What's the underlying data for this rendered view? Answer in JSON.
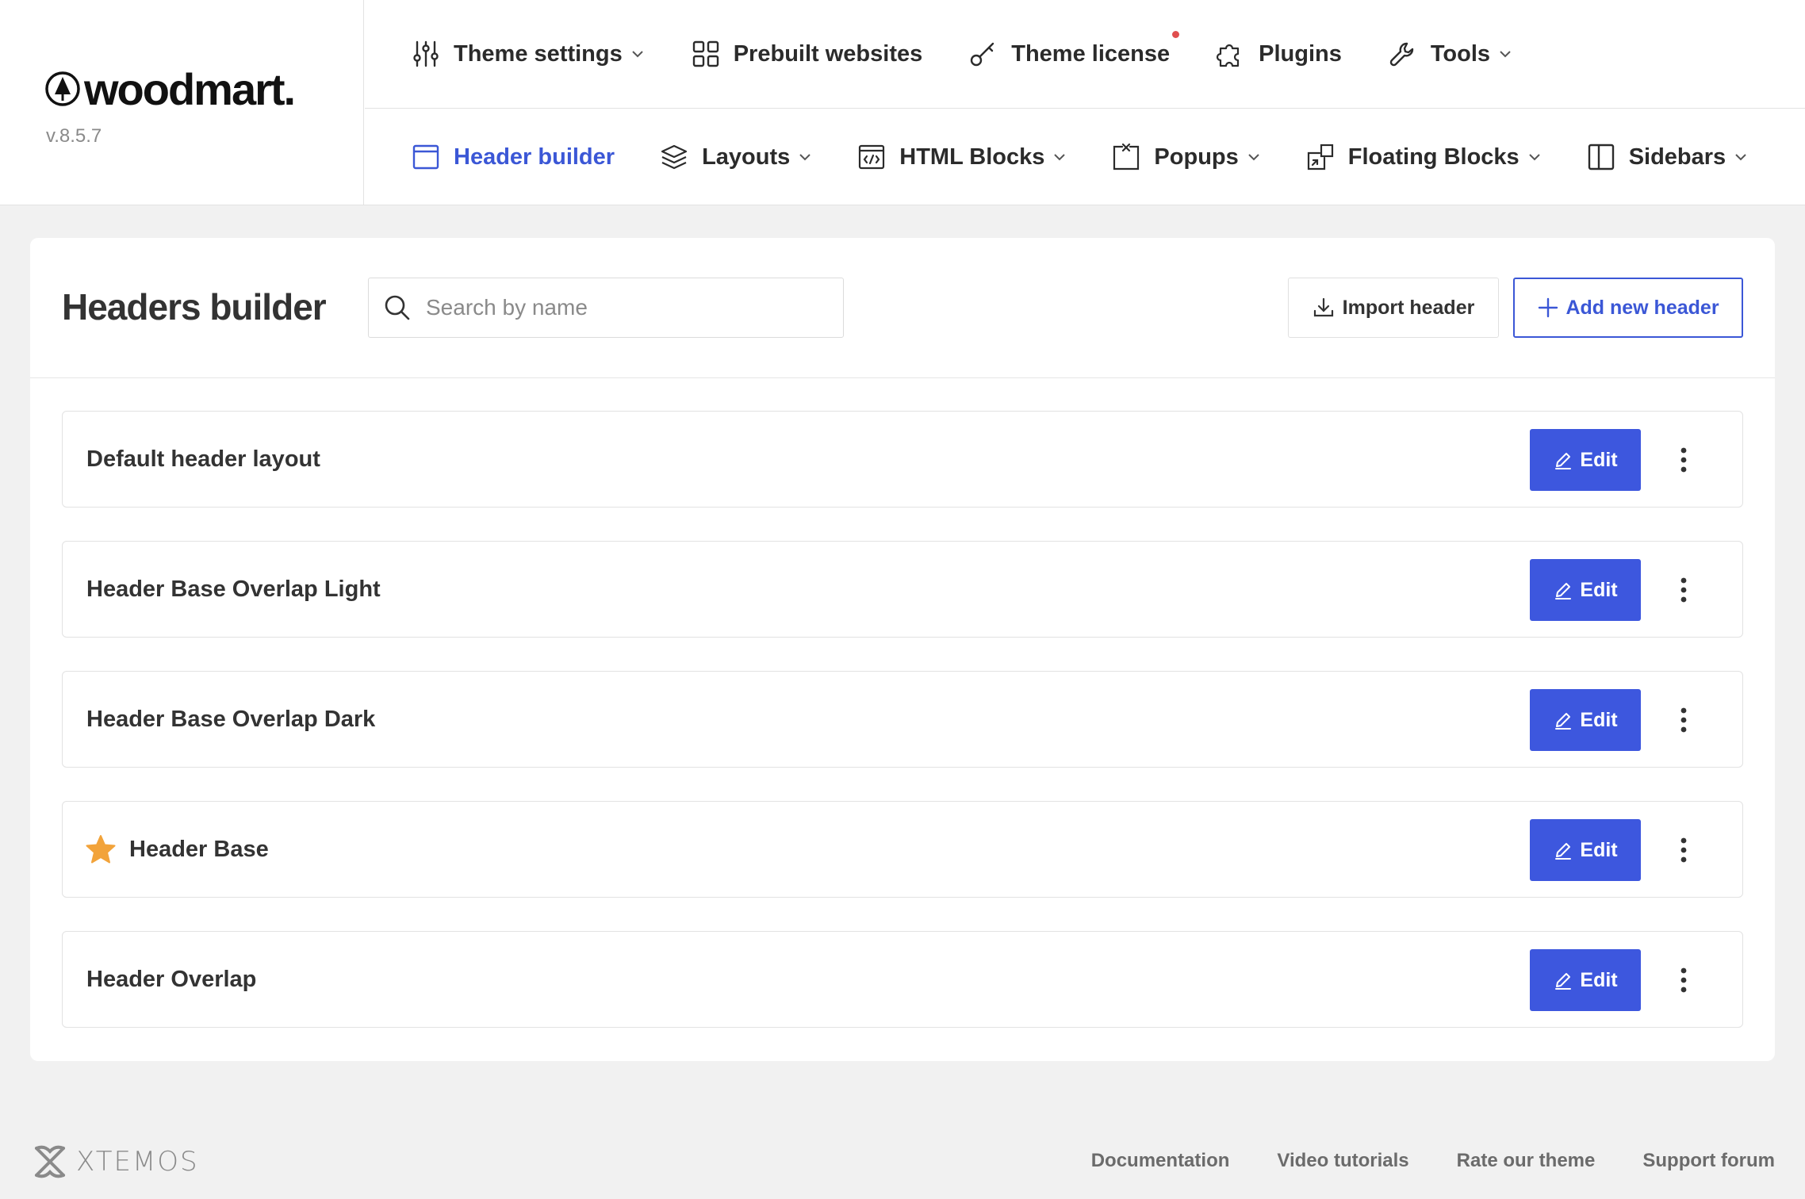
{
  "brand": {
    "name": "woodmart.",
    "version": "v.8.5.7"
  },
  "top_nav": [
    {
      "label": "Theme settings",
      "icon": "sliders-icon",
      "dropdown": true
    },
    {
      "label": "Prebuilt websites",
      "icon": "grid-icon",
      "dropdown": false
    },
    {
      "label": "Theme license",
      "icon": "key-icon",
      "dropdown": false,
      "notification_dot": true
    },
    {
      "label": "Plugins",
      "icon": "puzzle-icon",
      "dropdown": false
    },
    {
      "label": "Tools",
      "icon": "wrench-icon",
      "dropdown": true
    }
  ],
  "sub_nav": [
    {
      "label": "Header builder",
      "icon": "window-icon",
      "dropdown": false,
      "active": true
    },
    {
      "label": "Layouts",
      "icon": "layers-icon",
      "dropdown": true
    },
    {
      "label": "HTML Blocks",
      "icon": "code-window-icon",
      "dropdown": true
    },
    {
      "label": "Popups",
      "icon": "popup-icon",
      "dropdown": true
    },
    {
      "label": "Floating Blocks",
      "icon": "floating-icon",
      "dropdown": true
    },
    {
      "label": "Sidebars",
      "icon": "sidebar-icon",
      "dropdown": true
    }
  ],
  "panel": {
    "title": "Headers builder",
    "search_placeholder": "Search by name",
    "import_label": "Import header",
    "add_label": "Add new header"
  },
  "headers": [
    {
      "name": "Default header layout",
      "default": false
    },
    {
      "name": "Header Base Overlap Light",
      "default": false
    },
    {
      "name": "Header Base Overlap Dark",
      "default": false
    },
    {
      "name": "Header Base",
      "default": true
    },
    {
      "name": "Header Overlap",
      "default": false
    }
  ],
  "edit_label": "Edit",
  "footer": {
    "brand": "XTEMOS",
    "links": [
      "Documentation",
      "Video tutorials",
      "Rate our theme",
      "Support forum"
    ]
  },
  "colors": {
    "accent": "#3d57de",
    "active_text": "#3b57d6",
    "star": "#f2a33a",
    "dot": "#e04f4f"
  }
}
